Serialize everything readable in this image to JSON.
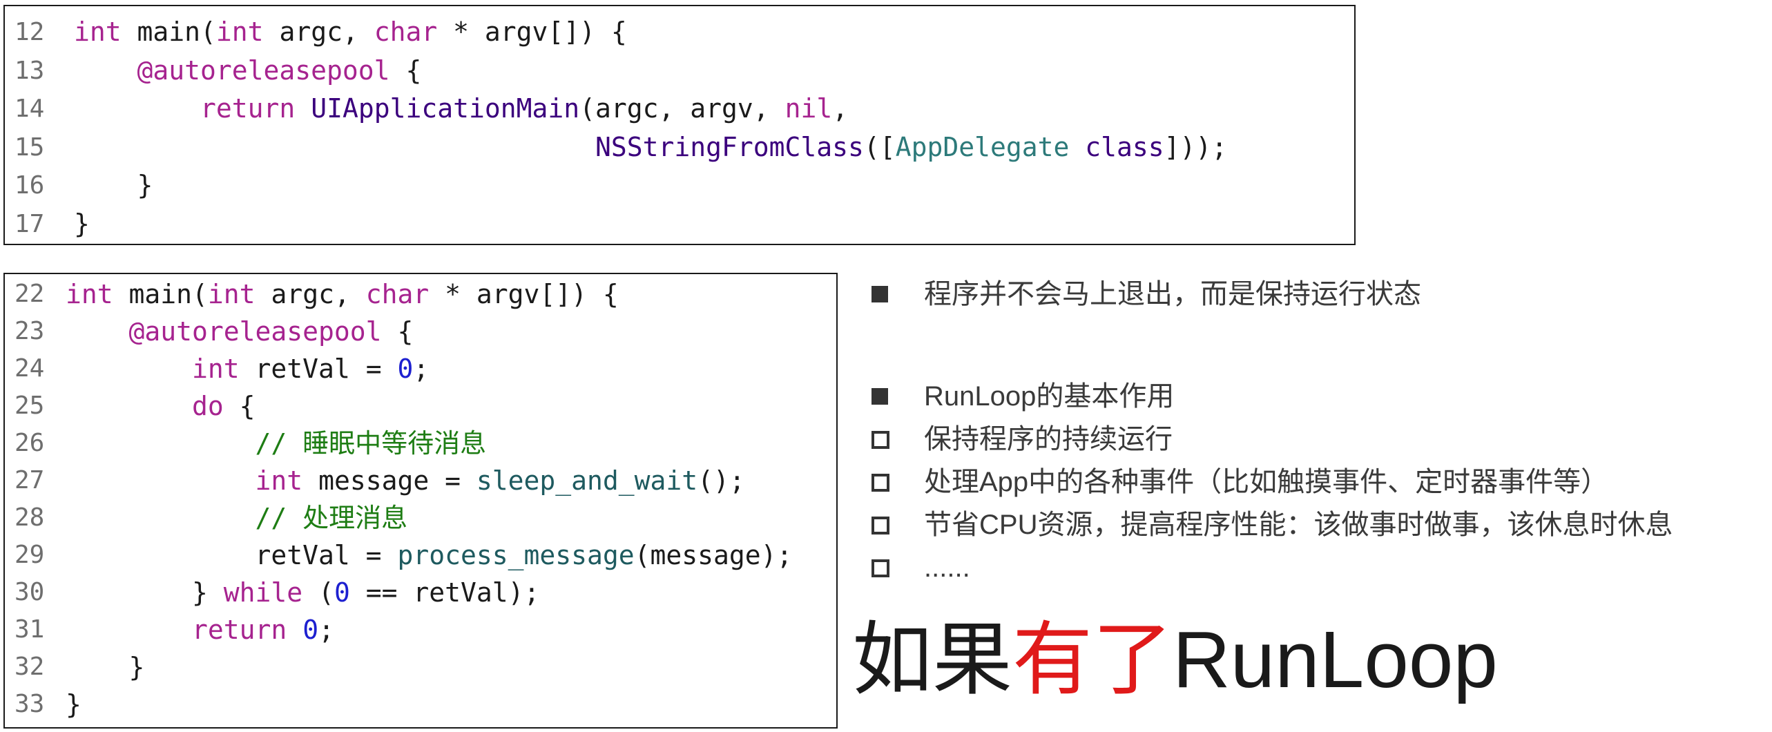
{
  "top_code": {
    "lines": [
      {
        "num": "12",
        "tokens": [
          {
            "t": "int",
            "c": "kw"
          },
          {
            "t": " main(",
            "c": "pl"
          },
          {
            "t": "int",
            "c": "kw"
          },
          {
            "t": " argc, ",
            "c": "pl"
          },
          {
            "t": "char",
            "c": "kw"
          },
          {
            "t": " * argv[]) {",
            "c": "pl"
          }
        ]
      },
      {
        "num": "13",
        "tokens": [
          {
            "t": "    ",
            "c": "pl"
          },
          {
            "t": "@autoreleasepool",
            "c": "kw"
          },
          {
            "t": " {",
            "c": "pl"
          }
        ]
      },
      {
        "num": "14",
        "tokens": [
          {
            "t": "        ",
            "c": "pl"
          },
          {
            "t": "return",
            "c": "kw"
          },
          {
            "t": " ",
            "c": "pl"
          },
          {
            "t": "UIApplicationMain",
            "c": "fn"
          },
          {
            "t": "(argc, argv, ",
            "c": "pl"
          },
          {
            "t": "nil",
            "c": "kw"
          },
          {
            "t": ",",
            "c": "pl"
          }
        ]
      },
      {
        "num": "15",
        "tokens": [
          {
            "t": "                                 ",
            "c": "pl"
          },
          {
            "t": "NSStringFromClass",
            "c": "fn"
          },
          {
            "t": "([",
            "c": "pl"
          },
          {
            "t": "AppDelegate",
            "c": "cls"
          },
          {
            "t": " ",
            "c": "pl"
          },
          {
            "t": "class",
            "c": "fn"
          },
          {
            "t": "]));",
            "c": "pl"
          }
        ]
      },
      {
        "num": "16",
        "tokens": [
          {
            "t": "    }",
            "c": "pl"
          }
        ]
      },
      {
        "num": "17",
        "tokens": [
          {
            "t": "}",
            "c": "pl"
          }
        ]
      }
    ]
  },
  "bottom_code": {
    "lines": [
      {
        "num": "22",
        "tokens": [
          {
            "t": "int",
            "c": "kw"
          },
          {
            "t": " main(",
            "c": "pl"
          },
          {
            "t": "int",
            "c": "kw"
          },
          {
            "t": " argc, ",
            "c": "pl"
          },
          {
            "t": "char",
            "c": "kw"
          },
          {
            "t": " * argv[]) {",
            "c": "pl"
          }
        ]
      },
      {
        "num": "23",
        "tokens": [
          {
            "t": "    ",
            "c": "pl"
          },
          {
            "t": "@autoreleasepool",
            "c": "kw"
          },
          {
            "t": " {",
            "c": "pl"
          }
        ]
      },
      {
        "num": "24",
        "tokens": [
          {
            "t": "        ",
            "c": "pl"
          },
          {
            "t": "int",
            "c": "kw"
          },
          {
            "t": " retVal = ",
            "c": "pl"
          },
          {
            "t": "0",
            "c": "num"
          },
          {
            "t": ";",
            "c": "pl"
          }
        ]
      },
      {
        "num": "25",
        "tokens": [
          {
            "t": "        ",
            "c": "pl"
          },
          {
            "t": "do",
            "c": "kw"
          },
          {
            "t": " {",
            "c": "pl"
          }
        ]
      },
      {
        "num": "26",
        "tokens": [
          {
            "t": "            ",
            "c": "pl"
          },
          {
            "t": "// 睡眠中等待消息",
            "c": "cm"
          }
        ]
      },
      {
        "num": "27",
        "tokens": [
          {
            "t": "            ",
            "c": "pl"
          },
          {
            "t": "int",
            "c": "kw"
          },
          {
            "t": " message = ",
            "c": "pl"
          },
          {
            "t": "sleep_and_wait",
            "c": "fn2"
          },
          {
            "t": "();",
            "c": "pl"
          }
        ]
      },
      {
        "num": "28",
        "tokens": [
          {
            "t": "            ",
            "c": "pl"
          },
          {
            "t": "// 处理消息",
            "c": "cm"
          }
        ]
      },
      {
        "num": "29",
        "tokens": [
          {
            "t": "            retVal = ",
            "c": "pl"
          },
          {
            "t": "process_message",
            "c": "fn2"
          },
          {
            "t": "(message);",
            "c": "pl"
          }
        ]
      },
      {
        "num": "30",
        "tokens": [
          {
            "t": "        } ",
            "c": "pl"
          },
          {
            "t": "while",
            "c": "kw"
          },
          {
            "t": " (",
            "c": "pl"
          },
          {
            "t": "0",
            "c": "num"
          },
          {
            "t": " == retVal);",
            "c": "pl"
          }
        ]
      },
      {
        "num": "31",
        "tokens": [
          {
            "t": "        ",
            "c": "pl"
          },
          {
            "t": "return",
            "c": "kw"
          },
          {
            "t": " ",
            "c": "pl"
          },
          {
            "t": "0",
            "c": "num"
          },
          {
            "t": ";",
            "c": "pl"
          }
        ]
      },
      {
        "num": "32",
        "tokens": [
          {
            "t": "    }",
            "c": "pl"
          }
        ]
      },
      {
        "num": "33",
        "tokens": [
          {
            "t": "}",
            "c": "pl"
          }
        ]
      }
    ]
  },
  "bullets": [
    {
      "style": "filled",
      "text": "程序并不会马上退出，而是保持运行状态"
    },
    {
      "style": "filled",
      "text": "RunLoop的基本作用"
    },
    {
      "style": "hollow",
      "text": "保持程序的持续运行"
    },
    {
      "style": "hollow",
      "text": "处理App中的各种事件（比如触摸事件、定时器事件等）"
    },
    {
      "style": "hollow",
      "text": "节省CPU资源，提高程序性能：该做事时做事，该休息时休息"
    },
    {
      "style": "hollow",
      "text": "......"
    }
  ],
  "headline": {
    "prefix": "如果",
    "highlight": "有了",
    "suffix": "RunLoop"
  },
  "colors": {
    "keyword": "#a6238f",
    "function": "#3b007d",
    "function_alt": "#1e5a5f",
    "class_name": "#2d7a7a",
    "number": "#1d20d0",
    "comment": "#1e7d14",
    "highlight_red": "#e01a1a"
  }
}
